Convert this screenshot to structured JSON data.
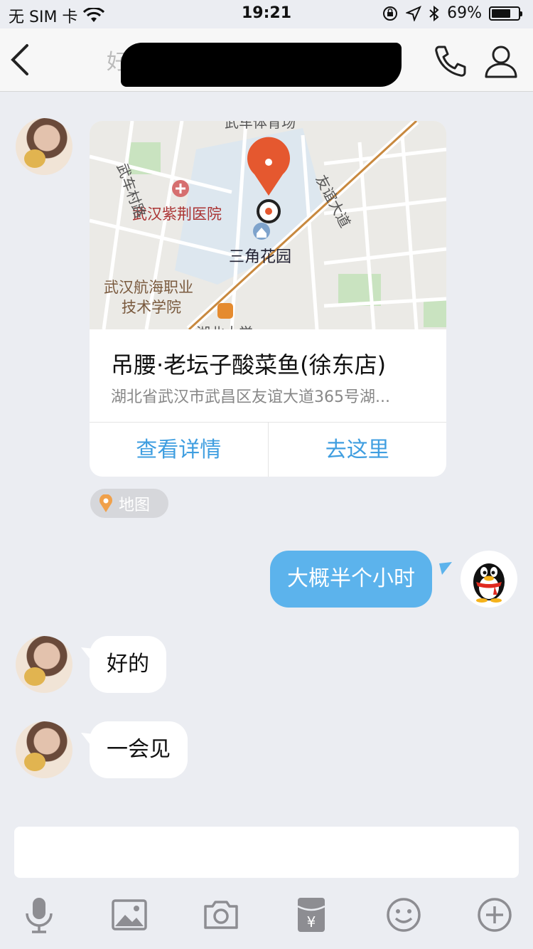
{
  "status_bar": {
    "carrier": "无 SIM 卡",
    "time": "19:21",
    "battery": "69%"
  },
  "nav": {
    "title_visible": "好"
  },
  "map_card": {
    "map_labels": {
      "hospital": "武汉紫荆医院",
      "park": "三角花园",
      "school_line1": "武汉航海职业",
      "school_line2": "技术学院",
      "road_left": "武车村路",
      "road_right": "友谊大道",
      "top_partial": "武车体育场",
      "bottom_partial": "湖北大学"
    },
    "place_name": "吊腰·老坛子酸菜鱼(徐东店)",
    "address": "湖北省武汉市武昌区友谊大道365号湖...",
    "view_details": "查看详情",
    "go_here": "去这里"
  },
  "map_tag": {
    "label": "地图"
  },
  "messages": {
    "out_1": "大概半个小时",
    "in_1": "好的",
    "in_2": "一会见"
  },
  "input": {
    "placeholder": ""
  },
  "colors": {
    "accent_blue": "#3f9ee0",
    "bubble_out": "#5cb3ec",
    "pin_orange": "#e5582f"
  }
}
